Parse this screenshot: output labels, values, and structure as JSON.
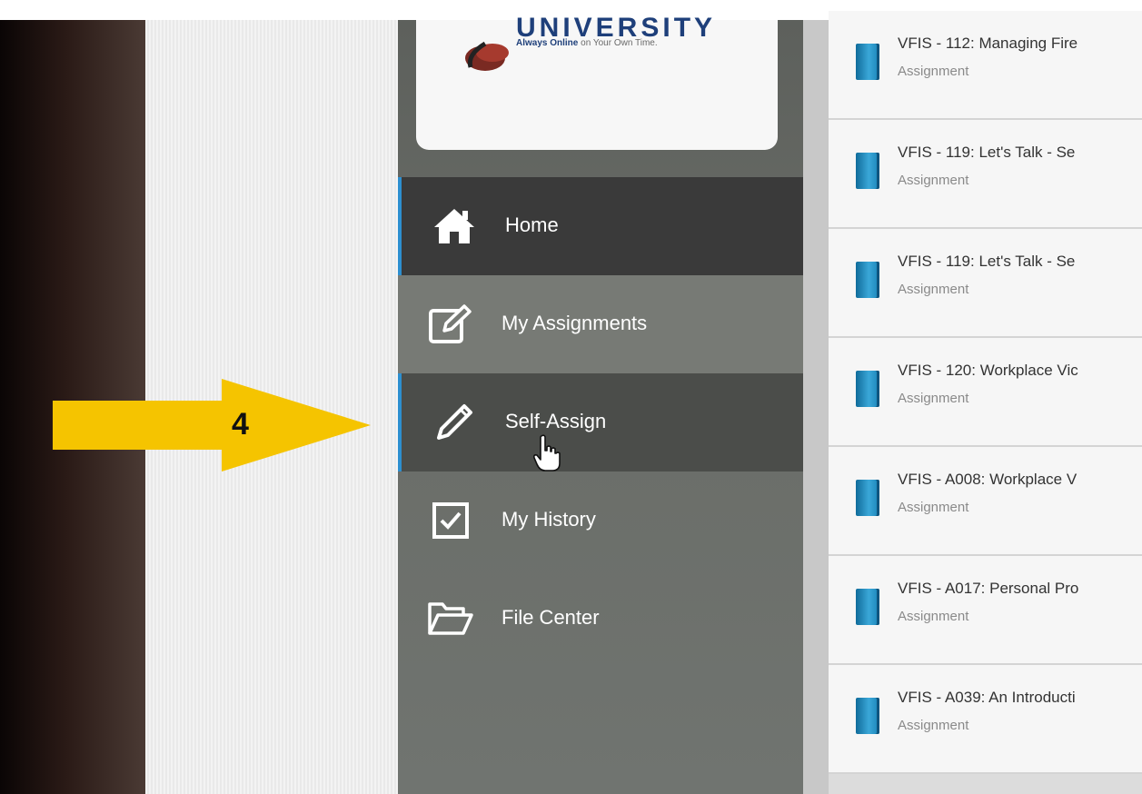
{
  "brand": {
    "wordmark": "UNIVERSITY",
    "tagline_strong": "Always Online",
    "tagline_rest": " on Your Own Time."
  },
  "nav": {
    "home": {
      "label": "Home",
      "icon": "home-icon"
    },
    "my_assignments": {
      "label": "My Assignments",
      "icon": "edit-icon"
    },
    "self_assign": {
      "label": "Self-Assign",
      "icon": "pencil-icon"
    },
    "my_history": {
      "label": "My History",
      "icon": "checkbox-icon"
    },
    "file_center": {
      "label": "File Center",
      "icon": "folder-icon"
    }
  },
  "assignments": [
    {
      "title": "VFIS - 112: Managing Fire",
      "type": "Assignment"
    },
    {
      "title": "VFIS - 119: Let's Talk - Se",
      "type": "Assignment"
    },
    {
      "title": "VFIS - 119: Let's Talk - Se",
      "type": "Assignment"
    },
    {
      "title": "VFIS - 120: Workplace Vic",
      "type": "Assignment"
    },
    {
      "title": "VFIS - A008: Workplace V",
      "type": "Assignment"
    },
    {
      "title": "VFIS - A017: Personal Pro",
      "type": "Assignment"
    },
    {
      "title": "VFIS - A039: An Introducti",
      "type": "Assignment"
    }
  ],
  "annotation": {
    "step": "4",
    "color": "#f5c400"
  },
  "colors": {
    "accent": "#2d8fd0",
    "sidebar": "#666965",
    "active_item": "#3a3a3a",
    "book_icon": "#2a93c8"
  }
}
